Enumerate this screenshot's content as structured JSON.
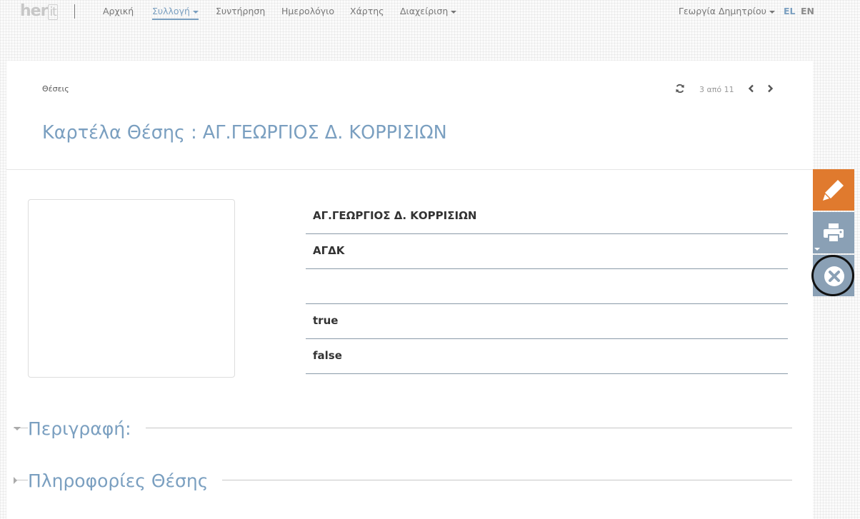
{
  "nav": {
    "logo_main": "her",
    "logo_suffix": "it",
    "items": [
      {
        "label": "Αρχική"
      },
      {
        "label": "Συλλογή"
      },
      {
        "label": "Συντήρηση"
      },
      {
        "label": "Ημερολόγιο"
      },
      {
        "label": "Χάρτης"
      },
      {
        "label": "Διαχείριση"
      }
    ],
    "user": "Γεωργία Δημητρίου",
    "langs": [
      {
        "code": "EL",
        "color": "#7a9fc0"
      },
      {
        "code": "EN",
        "color": "#8a8a8a"
      }
    ]
  },
  "header": {
    "breadcrumb": "Θέσεις",
    "pager": "3 από 11",
    "title": "Καρτέλα Θέσης : ΑΓ.ΓΕΩΡΓΙΟΣ Δ. ΚΟΡΡΙΣΙΩΝ"
  },
  "fields": [
    {
      "value": "ΑΓ.ΓΕΩΡΓΙΟΣ Δ. ΚΟΡΡΙΣΙΩΝ"
    },
    {
      "value": "ΑΓΔΚ"
    },
    {
      "value": ""
    },
    {
      "value": "true"
    },
    {
      "value": "false"
    }
  ],
  "sections": [
    {
      "label": "Περιγραφή:",
      "expanded": true
    },
    {
      "label": "Πληροφορίες Θέσης",
      "expanded": false
    }
  ],
  "toolbar": {
    "edit": {
      "icon": "pencil-icon",
      "color": "#e07a2e"
    },
    "print": {
      "icon": "print-icon",
      "color": "#8aa0b5"
    },
    "close": {
      "icon": "close-circle-icon",
      "color": "#8aa0b5"
    }
  },
  "colors": {
    "accent": "#7a9fc0",
    "edit_orange": "#e07a2e"
  }
}
